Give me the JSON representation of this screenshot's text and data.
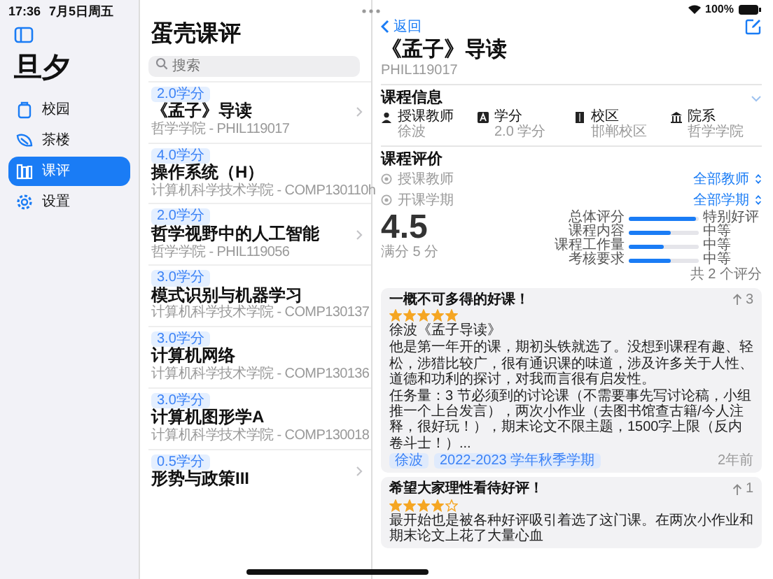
{
  "status_bar": {
    "time": "17:36",
    "date": "7月5日周五",
    "battery": "100%"
  },
  "sidebar": {
    "title": "旦夕",
    "items": [
      {
        "label": "校园",
        "selected": false
      },
      {
        "label": "茶楼",
        "selected": false
      },
      {
        "label": "课评",
        "selected": true
      },
      {
        "label": "设置",
        "selected": false
      }
    ]
  },
  "course_list": {
    "title": "蛋壳课评",
    "search": {
      "placeholder": "搜索"
    },
    "courses": [
      {
        "credit": "2.0学分",
        "title": "《孟子》导读",
        "subtitle": "哲学学院 - PHIL119017"
      },
      {
        "credit": "4.0学分",
        "title": "操作系统（H）",
        "subtitle": "计算机科学技术学院 - COMP130110h"
      },
      {
        "credit": "2.0学分",
        "title": "哲学视野中的人工智能",
        "subtitle": "哲学学院 - PHIL119056"
      },
      {
        "credit": "3.0学分",
        "title": "模式识别与机器学习",
        "subtitle": "计算机科学技术学院 - COMP130137"
      },
      {
        "credit": "3.0学分",
        "title": "计算机网络",
        "subtitle": "计算机科学技术学院 - COMP130136"
      },
      {
        "credit": "3.0学分",
        "title": "计算机图形学A",
        "subtitle": "计算机科学技术学院 - COMP130018"
      },
      {
        "credit": "0.5学分",
        "title": "形势与政策III"
      }
    ]
  },
  "detail": {
    "back": "返回",
    "title": "《孟子》导读",
    "code": "PHIL119017",
    "info": {
      "heading": "课程信息",
      "items": [
        {
          "label": "授课教师",
          "value": "徐波"
        },
        {
          "label": "学分",
          "value": "2.0 学分"
        },
        {
          "label": "校区",
          "value": "邯郸校区"
        },
        {
          "label": "院系",
          "value": "哲学学院"
        }
      ]
    },
    "evaluation": {
      "heading": "课程评价",
      "filters": [
        {
          "label": "授课教师",
          "value": "全部教师"
        },
        {
          "label": "开课学期",
          "value": "全部学期"
        }
      ],
      "score": "4.5",
      "score_note": "满分 5 分",
      "ratings": [
        {
          "label": "总体评分",
          "level": 0.95,
          "reading": "特别好评"
        },
        {
          "label": "课程内容",
          "level": 0.6,
          "reading": "中等"
        },
        {
          "label": "课程工作量",
          "level": 0.5,
          "reading": "中等"
        },
        {
          "label": "考核要求",
          "level": 0.6,
          "reading": "中等"
        }
      ],
      "count": "共 2 个评分"
    },
    "reviews": [
      {
        "title": "一概不可多得的好课！",
        "stars": 5,
        "upvotes": "3",
        "body": [
          "徐波《孟子导读》",
          "他是第一年开的课，期初头铁就选了。没想到课程有趣、轻松，涉猎比较广，很有通识课的味道，涉及许多关于人性、道德和功利的探讨，对我而言很有启发性。",
          "任务量：3 节必须到的讨论课（不需要事先写讨论稿，小组推一个上台发言），两次小作业（去图书馆查古籍/今人注释，很好玩！），期末论文不限主题，1500字上限（反内卷斗士！）..."
        ],
        "tags": [
          "徐波",
          "2022-2023 学年秋季学期"
        ],
        "time": "2年前"
      },
      {
        "title": "希望大家理性看待好评！",
        "stars": 4,
        "upvotes": "1",
        "body": [
          "最开始也是被各种好评吸引着选了这门课。在两次小作业和期末论文上花了大量心血"
        ]
      }
    ]
  }
}
